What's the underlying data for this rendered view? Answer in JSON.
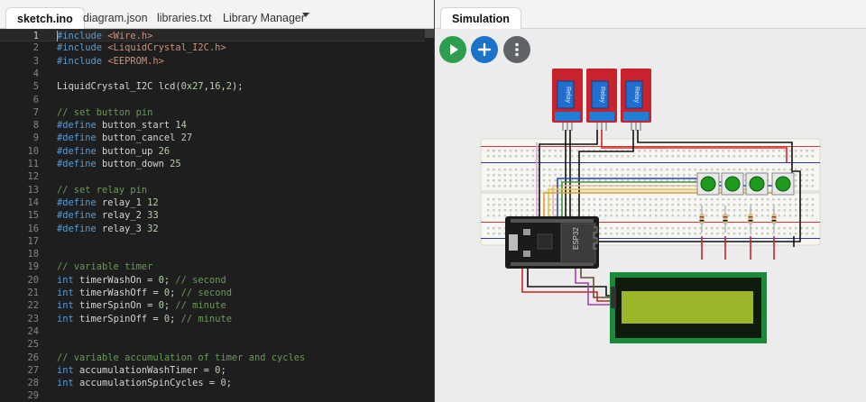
{
  "editor_tabs": [
    {
      "label": "sketch.ino"
    },
    {
      "label": "diagram.json"
    },
    {
      "label": "libraries.txt"
    },
    {
      "label": "Library Manager"
    }
  ],
  "sim_tab": {
    "label": "Simulation"
  },
  "code_lines": [
    {
      "n": "1",
      "t": [
        [
          "#include ",
          "#569cd6"
        ],
        [
          "<Wire.h>",
          "#ce9178"
        ]
      ]
    },
    {
      "n": "2",
      "t": [
        [
          "#include ",
          "#569cd6"
        ],
        [
          "<LiquidCrystal_I2C.h>",
          "#ce9178"
        ]
      ]
    },
    {
      "n": "3",
      "t": [
        [
          "#include ",
          "#569cd6"
        ],
        [
          "<EEPROM.h>",
          "#ce9178"
        ]
      ]
    },
    {
      "n": "4",
      "t": []
    },
    {
      "n": "5",
      "t": [
        [
          "LiquidCrystal_I2C lcd(",
          "#d4d4d4"
        ],
        [
          "0x27",
          "#b5cea8"
        ],
        [
          ",",
          "#d4d4d4"
        ],
        [
          "16",
          "#b5cea8"
        ],
        [
          ",",
          "#d4d4d4"
        ],
        [
          "2",
          "#b5cea8"
        ],
        [
          ");",
          "#d4d4d4"
        ]
      ]
    },
    {
      "n": "6",
      "t": []
    },
    {
      "n": "7",
      "t": [
        [
          "// set button pin",
          "#6a9955"
        ]
      ]
    },
    {
      "n": "8",
      "t": [
        [
          "#define ",
          "#569cd6"
        ],
        [
          "button_start ",
          "#d4d4d4"
        ],
        [
          "14",
          "#b5cea8"
        ]
      ]
    },
    {
      "n": "9",
      "t": [
        [
          "#define ",
          "#569cd6"
        ],
        [
          "button_cancel ",
          "#d4d4d4"
        ],
        [
          "27",
          "#b5cea8"
        ]
      ]
    },
    {
      "n": "10",
      "t": [
        [
          "#define ",
          "#569cd6"
        ],
        [
          "button_up ",
          "#d4d4d4"
        ],
        [
          "26",
          "#b5cea8"
        ]
      ]
    },
    {
      "n": "11",
      "t": [
        [
          "#define ",
          "#569cd6"
        ],
        [
          "button_down ",
          "#d4d4d4"
        ],
        [
          "25",
          "#b5cea8"
        ]
      ]
    },
    {
      "n": "12",
      "t": []
    },
    {
      "n": "13",
      "t": [
        [
          "// set relay pin",
          "#6a9955"
        ]
      ]
    },
    {
      "n": "14",
      "t": [
        [
          "#define ",
          "#569cd6"
        ],
        [
          "relay_1 ",
          "#d4d4d4"
        ],
        [
          "12",
          "#b5cea8"
        ]
      ]
    },
    {
      "n": "15",
      "t": [
        [
          "#define ",
          "#569cd6"
        ],
        [
          "relay_2 ",
          "#d4d4d4"
        ],
        [
          "33",
          "#b5cea8"
        ]
      ]
    },
    {
      "n": "16",
      "t": [
        [
          "#define ",
          "#569cd6"
        ],
        [
          "relay_3 ",
          "#d4d4d4"
        ],
        [
          "32",
          "#b5cea8"
        ]
      ]
    },
    {
      "n": "17",
      "t": []
    },
    {
      "n": "18",
      "t": []
    },
    {
      "n": "19",
      "t": [
        [
          "// variable timer",
          "#6a9955"
        ]
      ]
    },
    {
      "n": "20",
      "t": [
        [
          "int ",
          "#569cd6"
        ],
        [
          "timerWashOn = ",
          "#d4d4d4"
        ],
        [
          "0",
          "#b5cea8"
        ],
        [
          "; ",
          "#d4d4d4"
        ],
        [
          "// second",
          "#6a9955"
        ]
      ]
    },
    {
      "n": "21",
      "t": [
        [
          "int ",
          "#569cd6"
        ],
        [
          "timerWashOff = ",
          "#d4d4d4"
        ],
        [
          "0",
          "#b5cea8"
        ],
        [
          "; ",
          "#d4d4d4"
        ],
        [
          "// second",
          "#6a9955"
        ]
      ]
    },
    {
      "n": "22",
      "t": [
        [
          "int ",
          "#569cd6"
        ],
        [
          "timerSpinOn = ",
          "#d4d4d4"
        ],
        [
          "0",
          "#b5cea8"
        ],
        [
          "; ",
          "#d4d4d4"
        ],
        [
          "// minute",
          "#6a9955"
        ]
      ]
    },
    {
      "n": "23",
      "t": [
        [
          "int ",
          "#569cd6"
        ],
        [
          "timerSpinOff = ",
          "#d4d4d4"
        ],
        [
          "0",
          "#b5cea8"
        ],
        [
          "; ",
          "#d4d4d4"
        ],
        [
          "// minute",
          "#6a9955"
        ]
      ]
    },
    {
      "n": "24",
      "t": []
    },
    {
      "n": "25",
      "t": []
    },
    {
      "n": "26",
      "t": [
        [
          "// variable accumulation of timer and cycles",
          "#6a9955"
        ]
      ]
    },
    {
      "n": "27",
      "t": [
        [
          "int ",
          "#569cd6"
        ],
        [
          "accumulationWashTimer = ",
          "#d4d4d4"
        ],
        [
          "0",
          "#b5cea8"
        ],
        [
          ";",
          "#d4d4d4"
        ]
      ]
    },
    {
      "n": "28",
      "t": [
        [
          "int ",
          "#569cd6"
        ],
        [
          "accumulationSpinCycles = ",
          "#d4d4d4"
        ],
        [
          "0",
          "#b5cea8"
        ],
        [
          ";",
          "#d4d4d4"
        ]
      ]
    },
    {
      "n": "29",
      "t": []
    }
  ],
  "sim_buttons": [
    {
      "icon": "play-icon",
      "color": "#2d9e4f"
    },
    {
      "icon": "plus-icon",
      "color": "#1a73c8"
    },
    {
      "icon": "more-vertical-icon",
      "color": "#5f6368"
    }
  ],
  "relay_module": {
    "label": "Relay",
    "count": 3
  },
  "mcu": {
    "label": "ESP32"
  },
  "lcd": {
    "screen_color": "#9bb629",
    "frame_color": "#1a8a3a"
  }
}
